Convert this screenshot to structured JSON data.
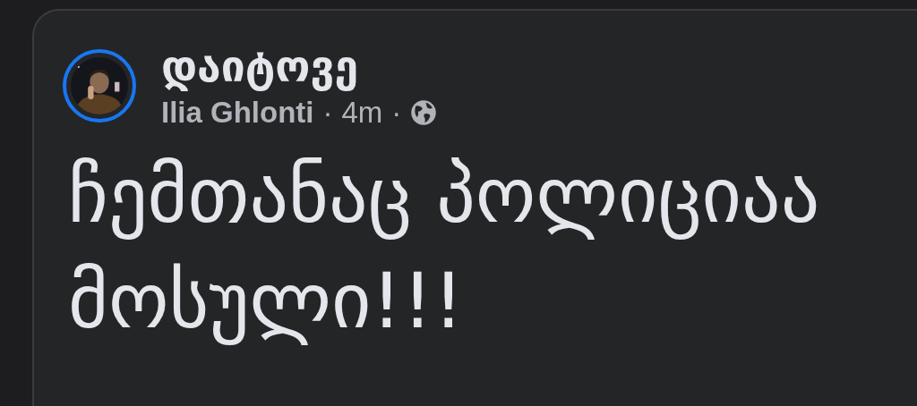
{
  "post": {
    "group_name": "დაიტოვე",
    "author": "Ilia Ghlonti",
    "separator_1": "·",
    "time": "4m",
    "separator_2": "·",
    "text": [
      "ჩემთანაც პოლიციაა",
      "მოსული!!!"
    ],
    "avatar": {
      "kind": "picture",
      "story_ring": true
    }
  }
}
